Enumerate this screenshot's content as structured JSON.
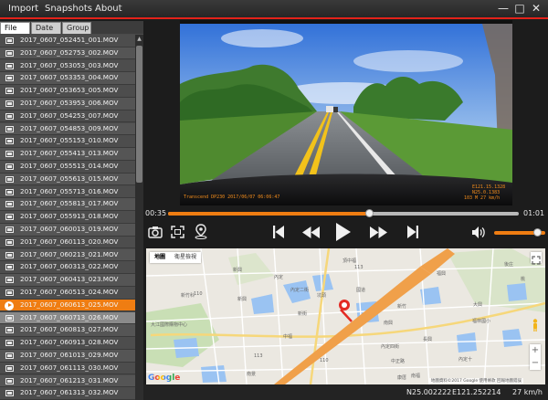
{
  "menu": {
    "import": "Import",
    "snapshots": "Snapshots",
    "about": "About"
  },
  "window": {
    "minimize": "—",
    "maximize": "□",
    "close": "✕"
  },
  "tabs": [
    {
      "label": "File",
      "active": true
    },
    {
      "label": "Date",
      "active": false
    },
    {
      "label": "Group",
      "active": false
    }
  ],
  "files": [
    {
      "name": "2017_0607_052451_001.MOV",
      "state": "normal"
    },
    {
      "name": "2017_0607_052753_002.MOV",
      "state": "normal"
    },
    {
      "name": "2017_0607_053053_003.MOV",
      "state": "normal"
    },
    {
      "name": "2017_0607_053353_004.MOV",
      "state": "normal"
    },
    {
      "name": "2017_0607_053653_005.MOV",
      "state": "normal"
    },
    {
      "name": "2017_0607_053953_006.MOV",
      "state": "normal"
    },
    {
      "name": "2017_0607_054253_007.MOV",
      "state": "normal"
    },
    {
      "name": "2017_0607_054853_009.MOV",
      "state": "normal"
    },
    {
      "name": "2017_0607_055153_010.MOV",
      "state": "normal"
    },
    {
      "name": "2017_0607_055413_013.MOV",
      "state": "normal"
    },
    {
      "name": "2017_0607_055513_014.MOV",
      "state": "normal"
    },
    {
      "name": "2017_0607_055613_015.MOV",
      "state": "normal"
    },
    {
      "name": "2017_0607_055713_016.MOV",
      "state": "normal"
    },
    {
      "name": "2017_0607_055813_017.MOV",
      "state": "normal"
    },
    {
      "name": "2017_0607_055913_018.MOV",
      "state": "normal"
    },
    {
      "name": "2017_0607_060013_019.MOV",
      "state": "normal"
    },
    {
      "name": "2017_0607_060113_020.MOV",
      "state": "normal"
    },
    {
      "name": "2017_0607_060213_021.MOV",
      "state": "normal"
    },
    {
      "name": "2017_0607_060313_022.MOV",
      "state": "normal"
    },
    {
      "name": "2017_0607_060413_023.MOV",
      "state": "normal"
    },
    {
      "name": "2017_0607_060513_024.MOV",
      "state": "normal"
    },
    {
      "name": "2017_0607_060613_025.MOV",
      "state": "playing"
    },
    {
      "name": "2017_0607_060713_026.MOV",
      "state": "selected"
    },
    {
      "name": "2017_0607_060813_027.MOV",
      "state": "normal"
    },
    {
      "name": "2017_0607_060913_028.MOV",
      "state": "normal"
    },
    {
      "name": "2017_0607_061013_029.MOV",
      "state": "normal"
    },
    {
      "name": "2017_0607_061113_030.MOV",
      "state": "normal"
    },
    {
      "name": "2017_0607_061213_031.MOV",
      "state": "normal"
    },
    {
      "name": "2017_0607_061313_032.MOV",
      "state": "normal"
    }
  ],
  "video": {
    "osd_left": "Transcend DP230 2017/06/07 06:06:47",
    "osd_right_1": "E121.15.1328",
    "osd_right_2": "N25.0.1383",
    "osd_right_3": "103 M   27 km/h"
  },
  "playback": {
    "current_time": "00:35",
    "total_time": "01:01",
    "progress": 0.574,
    "volume": 0.85
  },
  "controls": {
    "snapshot_icon": "camera-icon",
    "fullscreen_icon": "expand-icon",
    "location_icon": "map-pin-icon",
    "prev_icon": "skip-previous-icon",
    "rewind_icon": "rewind-icon",
    "play_icon": "play-icon",
    "forward_icon": "fast-forward-icon",
    "next_icon": "skip-next-icon",
    "volume_icon": "speaker-icon"
  },
  "map": {
    "type_map": "地圖",
    "type_satellite": "衛星檢視",
    "labels": [
      "大江國際購物中心",
      "新竹科",
      "坑頭",
      "頂中福",
      "福興",
      "內定",
      "新興",
      "新街",
      "南興",
      "大興",
      "後庄",
      "福林國小",
      "內定四街",
      "110",
      "110",
      "113",
      "113",
      "桃",
      "中福",
      "新竹",
      "長興",
      "南景",
      "內定二街",
      "中正路",
      "國道",
      "新興",
      "南福",
      "內定十",
      "康厝"
    ],
    "attribution": "地圖資料©2017 Google   使用條款   回報地圖錯誤",
    "google": "Google",
    "zoom_in": "+",
    "zoom_out": "−"
  },
  "status": {
    "latitude": "N25.002222",
    "longitude": "E121.252214",
    "speed": "27 km/h"
  },
  "colors": {
    "accent": "#ef7d12",
    "menu_underline": "#e3221a"
  }
}
